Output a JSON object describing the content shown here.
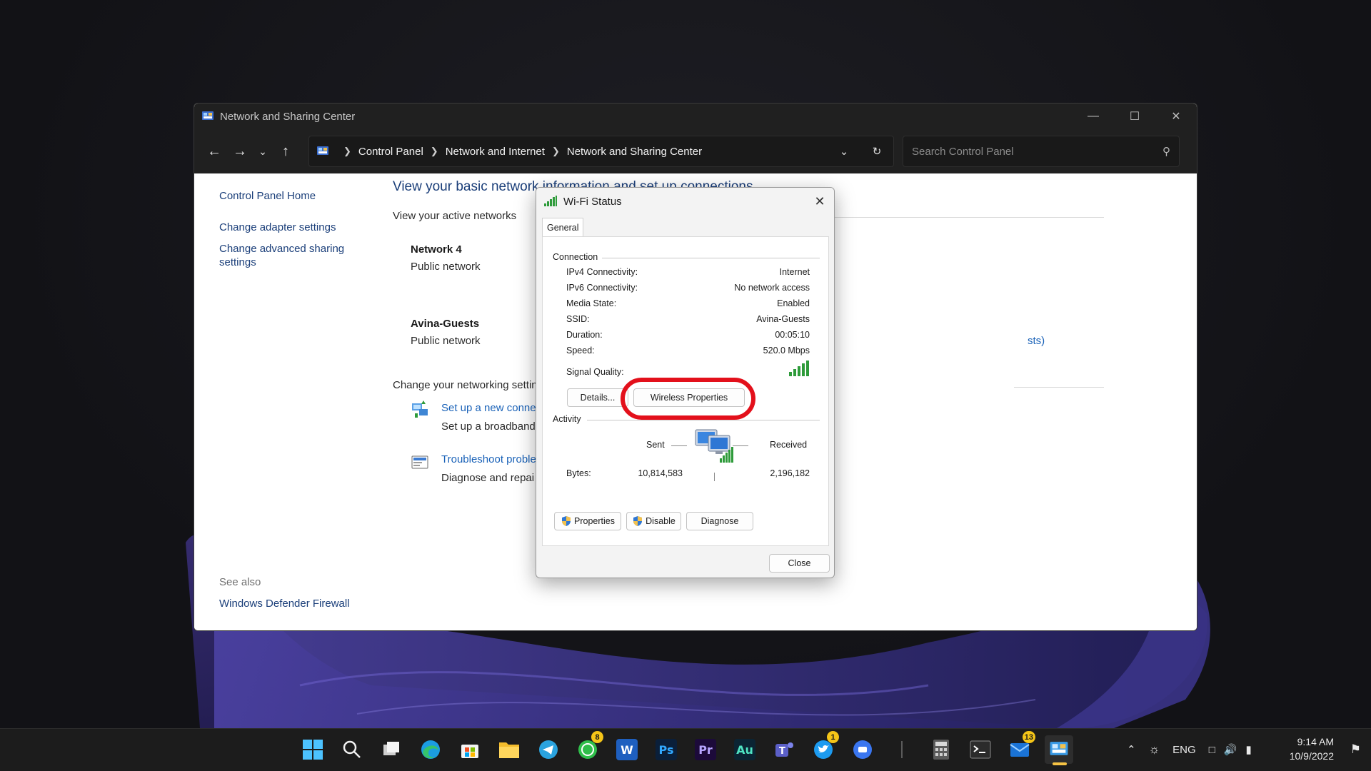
{
  "window": {
    "title": "Network and Sharing Center",
    "minimize_icon": "minimize-icon",
    "maximize_icon": "maximize-icon",
    "close_icon": "close-icon"
  },
  "toolbar": {
    "breadcrumbs": [
      "Control Panel",
      "Network and Internet",
      "Network and Sharing Center"
    ],
    "search_placeholder": "Search Control Panel"
  },
  "leftnav": {
    "items": [
      "Control Panel Home",
      "Change adapter settings",
      "Change advanced sharing",
      "settings"
    ],
    "see_also_label": "See also",
    "see_also_link": "Windows Defender Firewall"
  },
  "main": {
    "heading": "View your basic network information and set up connections",
    "active_networks_label": "View your active networks",
    "networks": [
      {
        "name": "Network 4",
        "type": "Public network"
      },
      {
        "name": "Avina-Guests",
        "type": "Public network",
        "partial_link": "sts)"
      }
    ],
    "change_settings_label": "Change your networking settin",
    "tasks": [
      {
        "link": "Set up a new connec",
        "desc": "Set up a broadband"
      },
      {
        "link": "Troubleshoot proble",
        "desc": "Diagnose and repai"
      }
    ]
  },
  "dialog": {
    "title": "Wi-Fi Status",
    "tab": "General",
    "connection_label": "Connection",
    "rows": [
      {
        "label": "IPv4 Connectivity:",
        "value": "Internet"
      },
      {
        "label": "IPv6 Connectivity:",
        "value": "No network access"
      },
      {
        "label": "Media State:",
        "value": "Enabled"
      },
      {
        "label": "SSID:",
        "value": "Avina-Guests"
      },
      {
        "label": "Duration:",
        "value": "00:05:10"
      },
      {
        "label": "Speed:",
        "value": "520.0 Mbps"
      }
    ],
    "signal_label": "Signal Quality:",
    "details_button": "Details...",
    "wireless_button": "Wireless Properties",
    "activity_label": "Activity",
    "sent_label": "Sent",
    "received_label": "Received",
    "bytes_label": "Bytes:",
    "bytes_sent": "10,814,583",
    "bytes_received": "2,196,182",
    "properties_button": "Properties",
    "disable_button": "Disable",
    "diagnose_button": "Diagnose",
    "close_button": "Close"
  },
  "taskbar": {
    "apps": [
      {
        "name": "start",
        "icon": "windows-logo-icon"
      },
      {
        "name": "search",
        "icon": "search-icon"
      },
      {
        "name": "task-view",
        "icon": "task-view-icon"
      },
      {
        "name": "edge",
        "icon": "edge-icon"
      },
      {
        "name": "store",
        "icon": "store-icon"
      },
      {
        "name": "file-explorer",
        "icon": "folder-icon"
      },
      {
        "name": "telegram",
        "icon": "telegram-icon"
      },
      {
        "name": "whatsapp",
        "icon": "whatsapp-icon",
        "badge": "8"
      },
      {
        "name": "word",
        "icon": "word-icon",
        "label": "W"
      },
      {
        "name": "photoshop",
        "icon": "photoshop-icon",
        "label": "Ps"
      },
      {
        "name": "premiere",
        "icon": "premiere-icon",
        "label": "Pr"
      },
      {
        "name": "audition",
        "icon": "audition-icon",
        "label": "Au"
      },
      {
        "name": "teams",
        "icon": "teams-icon"
      },
      {
        "name": "twitter",
        "icon": "twitter-icon",
        "badge": "1"
      },
      {
        "name": "signal",
        "icon": "chat-icon"
      },
      {
        "name": "calculator",
        "icon": "calculator-icon"
      },
      {
        "name": "terminal",
        "icon": "terminal-icon"
      },
      {
        "name": "mail",
        "icon": "mail-icon",
        "badge": "13"
      },
      {
        "name": "control-panel",
        "icon": "control-panel-icon"
      }
    ],
    "language": "ENG",
    "time": "9:14 AM",
    "date": "10/9/2022"
  },
  "colors": {
    "highlight": "#e3101b",
    "link": "#1a3e79",
    "signal": "#2e9b3a"
  }
}
